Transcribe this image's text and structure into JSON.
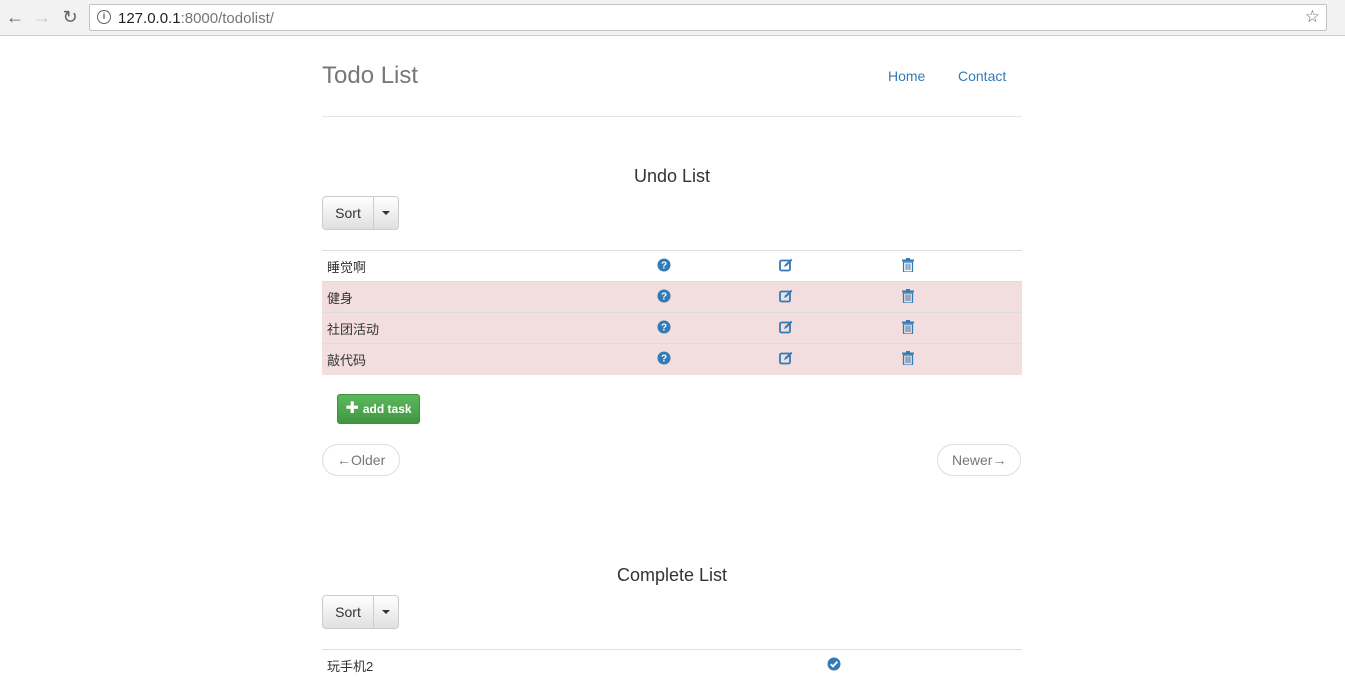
{
  "browser": {
    "url_host": "127.0.0.1",
    "url_rest": ":8000/todolist/"
  },
  "header": {
    "brand": "Todo List",
    "nav": [
      "Home",
      "Contact"
    ]
  },
  "undo": {
    "title": "Undo List",
    "sort_label": "Sort",
    "tasks": [
      {
        "name": "睡觉啊",
        "highlight": false
      },
      {
        "name": "健身",
        "highlight": true
      },
      {
        "name": "社团活动",
        "highlight": true
      },
      {
        "name": "敲代码",
        "highlight": true
      }
    ],
    "add_label": "add task",
    "older_label": "←Older",
    "newer_label": "Newer→"
  },
  "complete": {
    "title": "Complete List",
    "sort_label": "Sort",
    "tasks": [
      {
        "name": "玩手机2"
      }
    ]
  },
  "colors": {
    "link": "#337ab7",
    "danger_row": "#f2dede",
    "success": "#5cb85c",
    "icon": "#337ab7"
  },
  "icons": [
    "question-icon",
    "edit-icon",
    "trash-icon",
    "check-icon",
    "plus-icon"
  ]
}
